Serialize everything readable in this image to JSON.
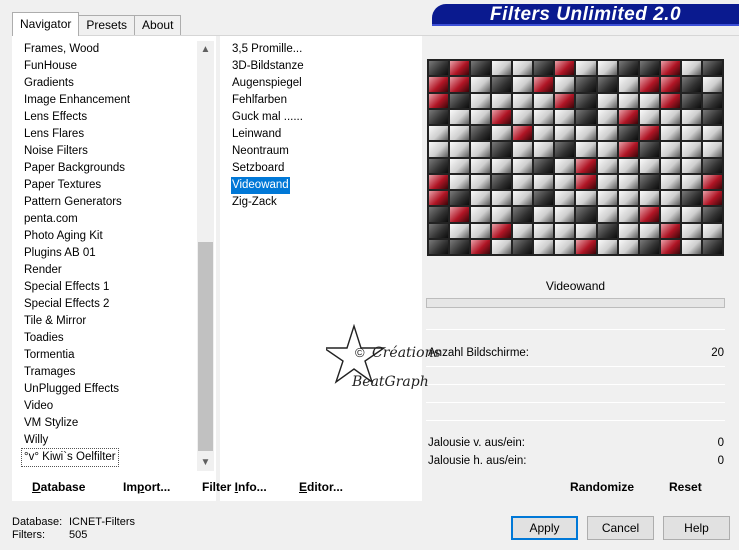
{
  "banner": {
    "title": "Filters Unlimited 2.0"
  },
  "tabs": [
    {
      "label": "Navigator",
      "active": true
    },
    {
      "label": "Presets",
      "active": false
    },
    {
      "label": "About",
      "active": false
    }
  ],
  "categories": [
    "Frames, Wood",
    "FunHouse",
    "Gradients",
    "Image Enhancement",
    "Lens Effects",
    "Lens Flares",
    "Noise Filters",
    "Paper Backgrounds",
    "Paper Textures",
    "Pattern Generators",
    "penta.com",
    "Photo Aging Kit",
    "Plugins AB 01",
    "Render",
    "Special Effects 1",
    "Special Effects 2",
    "Tile & Mirror",
    "Toadies",
    "Tormentia",
    "Tramages",
    "UnPlugged Effects",
    "Video",
    "VM Stylize",
    "Willy",
    "°v° Kiwi`s Oelfilter"
  ],
  "filters": [
    "3,5 Promille...",
    "3D-Bildstanze",
    "Augenspiegel",
    "Fehlfarben",
    "Guck mal ......",
    "Leinwand",
    "Neontraum",
    "Setzboard",
    "Videowand",
    "Zig-Zack"
  ],
  "selected_filter": "Videowand",
  "links": {
    "database": {
      "u": "D",
      "rest": "atabase"
    },
    "import": {
      "pre": "Im",
      "u": "p",
      "rest": "ort..."
    },
    "filterinfo": {
      "pre": "Filter ",
      "u": "I",
      "rest": "nfo..."
    },
    "editor": {
      "u": "E",
      "rest": "ditor..."
    }
  },
  "filter_title": "Videowand",
  "params": [
    {
      "label": "Anzahl Bildschirme:",
      "value": "20"
    },
    {
      "label": "Jalousie v. aus/ein:",
      "value": "0"
    },
    {
      "label": "Jalousie h. aus/ein:",
      "value": "0"
    }
  ],
  "right_buttons": {
    "randomize": "Randomize",
    "reset": "Reset"
  },
  "status": {
    "db_key": "Database:",
    "db_val": "ICNET-Filters",
    "filters_key": "Filters:",
    "filters_val": "505"
  },
  "buttons": {
    "apply": "Apply",
    "cancel": "Cancel",
    "help": "Help"
  },
  "watermark": {
    "copy": "©",
    "line1": "Créations",
    "line2": "BeatGraph"
  }
}
